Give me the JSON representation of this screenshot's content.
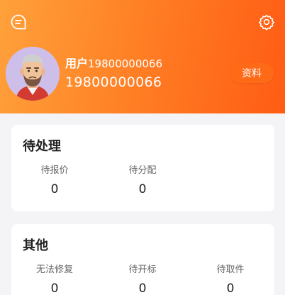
{
  "header": {
    "user_prefix": "用户",
    "user_suffix": "19800000066",
    "phone": "19800000066",
    "profile_button": "资料",
    "icons": [
      "chat-bubble-icon",
      "gear-icon"
    ]
  },
  "pending": {
    "title": "待处理",
    "items": [
      {
        "label": "待报价",
        "count": "0"
      },
      {
        "label": "待分配",
        "count": "0"
      }
    ]
  },
  "other": {
    "title": "其他",
    "items": [
      {
        "label": "无法修复",
        "count": "0"
      },
      {
        "label": "待开标",
        "count": "0"
      },
      {
        "label": "待取件",
        "count": "0"
      }
    ]
  },
  "colors": {
    "accent_start": "#ffa13a",
    "accent_end": "#ff5c14",
    "background": "#f4f4f6"
  }
}
